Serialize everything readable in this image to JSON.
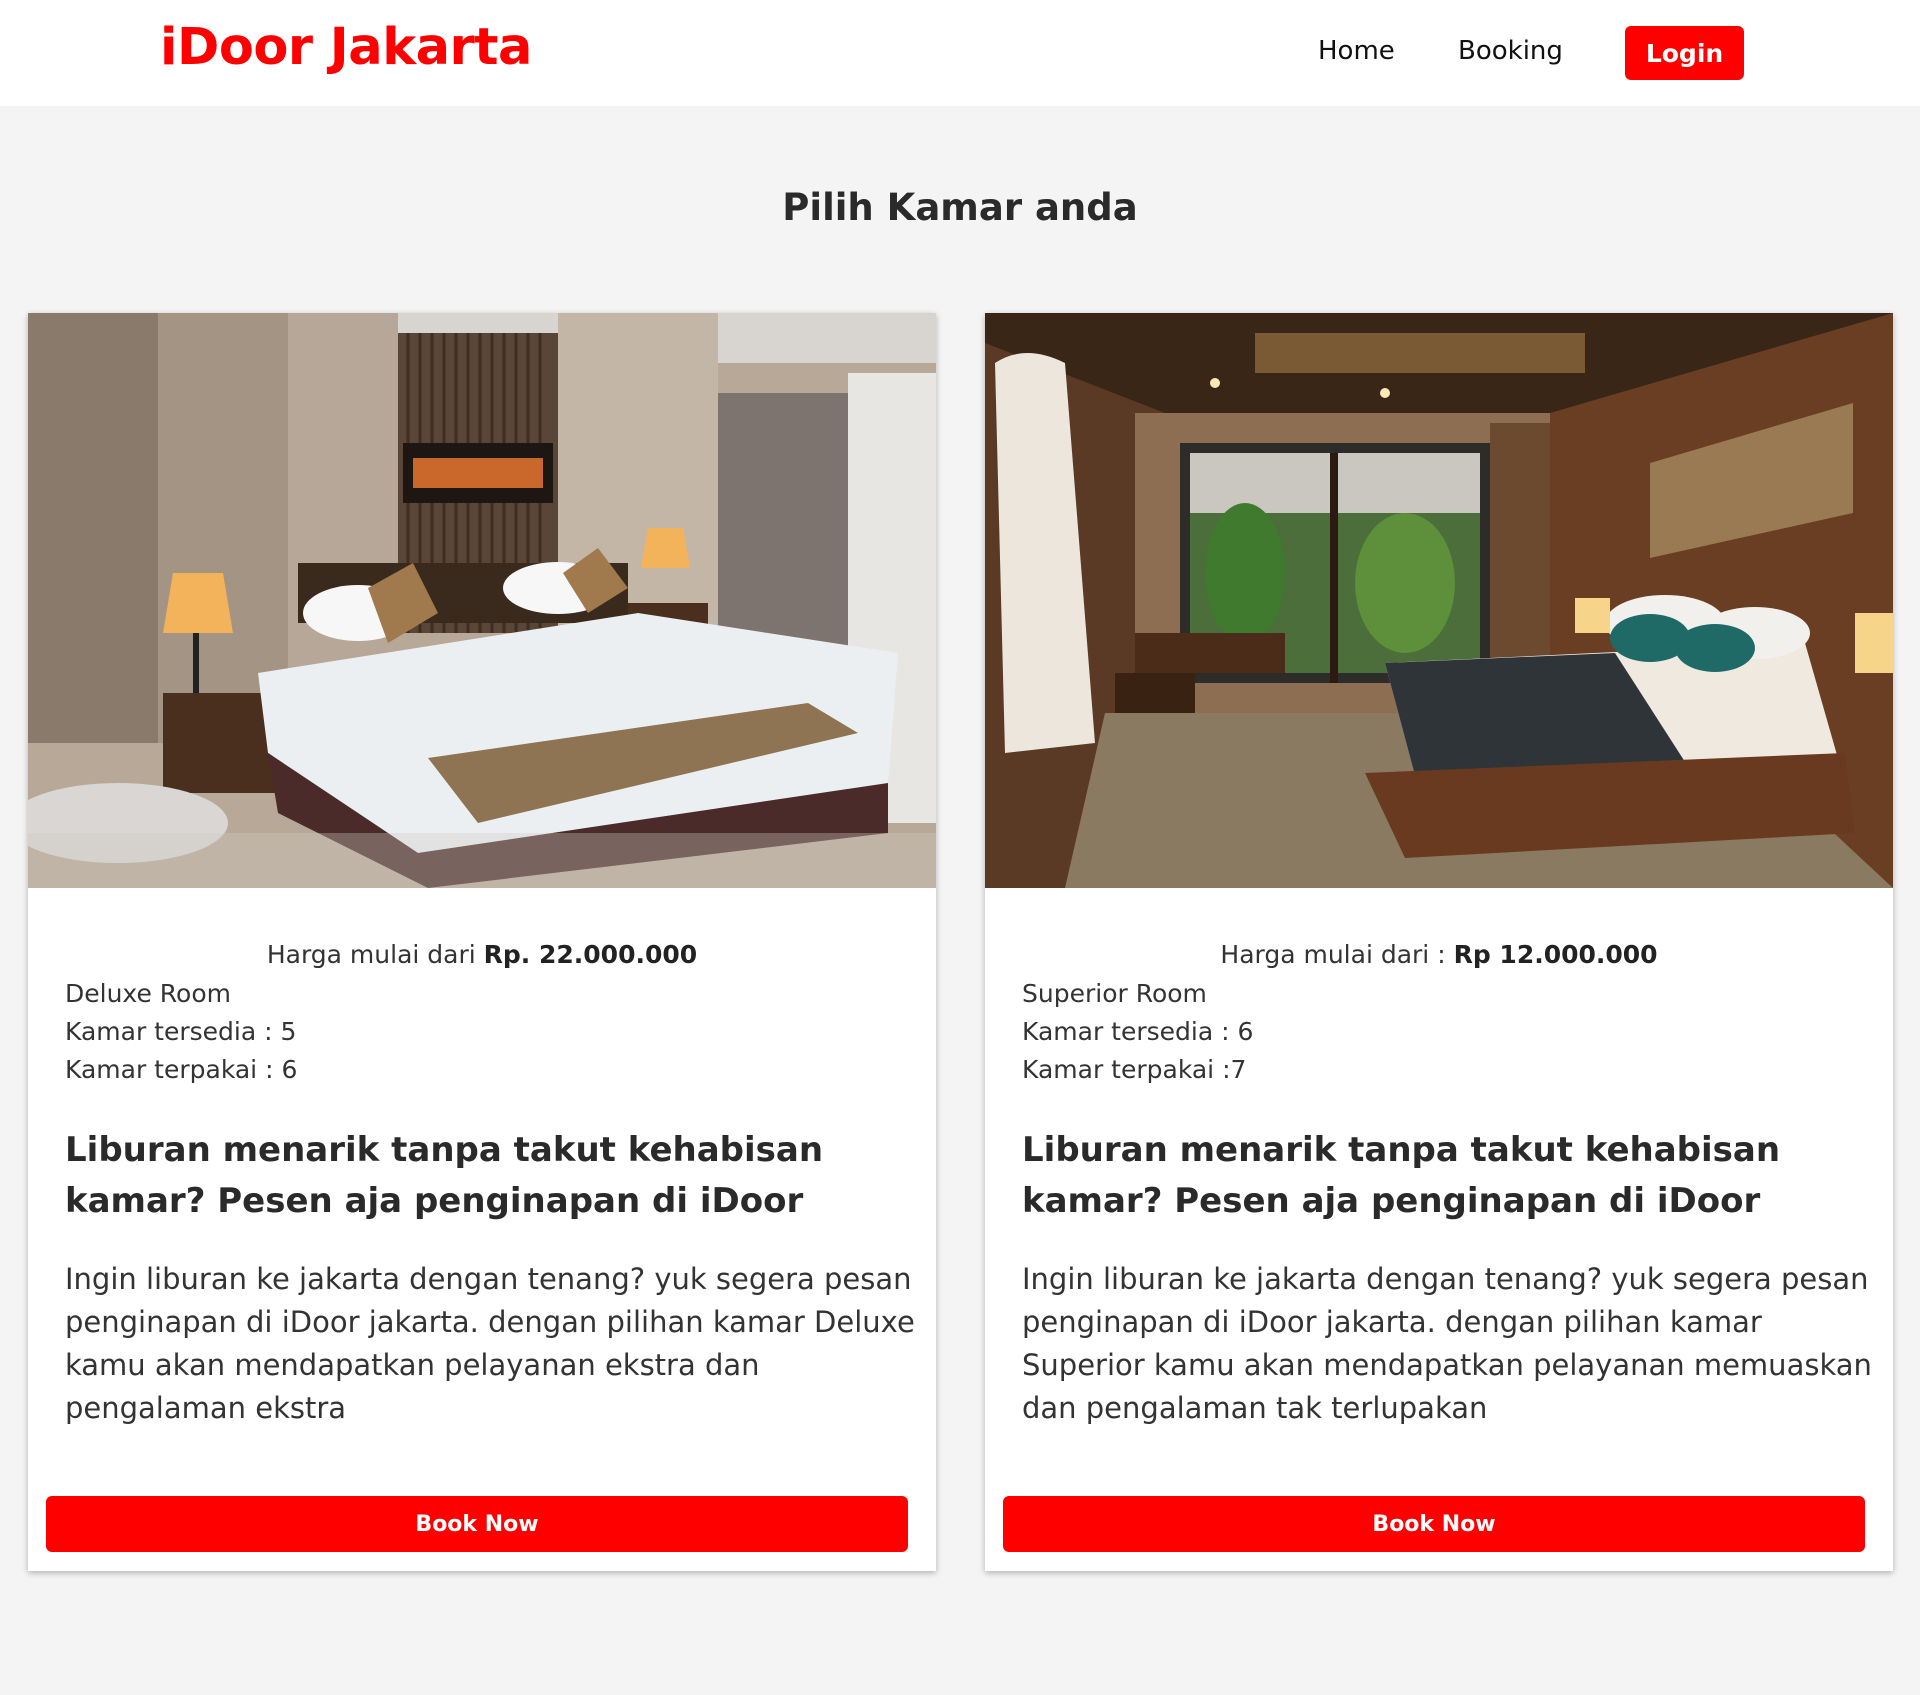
{
  "navbar": {
    "brand": "iDoor Jakarta",
    "links": [
      "Home",
      "Booking"
    ],
    "login_label": "Login"
  },
  "main": {
    "title": "Pilih Kamar anda"
  },
  "rooms": [
    {
      "price_prefix": "Harga mulai dari ",
      "price_value": "Rp. 22.000.000",
      "room_type": "Deluxe Room",
      "available": "Kamar tersedia : 5",
      "used": "Kamar terpakai : 6",
      "headline": "Liburan menarik tanpa takut kehabisan kamar? Pesen aja penginapan di iDoor",
      "description": "Ingin liburan ke jakarta dengan tenang? yuk segera pesan penginapan di iDoor jakarta. dengan pilihan kamar Deluxe kamu akan mendapatkan pelayanan ekstra dan pengalaman ekstra",
      "button_label": "Book Now"
    },
    {
      "price_prefix": "Harga mulai dari : ",
      "price_value": "Rp 12.000.000",
      "room_type": "Superior Room",
      "available": "Kamar tersedia : 6",
      "used": "Kamar terpakai :7",
      "headline": "Liburan menarik tanpa takut kehabisan kamar? Pesen aja penginapan di iDoor",
      "description": "Ingin liburan ke jakarta dengan tenang? yuk segera pesan penginapan di iDoor jakarta. dengan pilihan kamar Superior kamu akan mendapatkan pelayanan memuaskan dan pengalaman tak terlupakan",
      "button_label": "Book Now"
    }
  ],
  "colors": {
    "brand": "#ff0000",
    "background": "#f4f4f4",
    "card": "#ffffff"
  }
}
